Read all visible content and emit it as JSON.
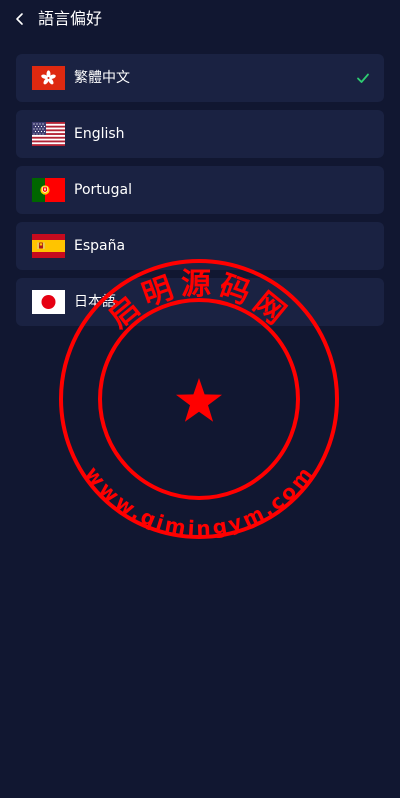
{
  "header": {
    "title": "語言偏好",
    "back_icon": "chevron-left-icon"
  },
  "languages": [
    {
      "label": "繁體中文",
      "flag": "hong-kong-flag-icon",
      "selected": true
    },
    {
      "label": "English",
      "flag": "us-flag-icon",
      "selected": false
    },
    {
      "label": "Portugal",
      "flag": "portugal-flag-icon",
      "selected": false
    },
    {
      "label": "España",
      "flag": "spain-flag-icon",
      "selected": false
    },
    {
      "label": "日本語",
      "flag": "japan-flag-icon",
      "selected": false
    }
  ],
  "watermark": {
    "top_text": "启明源码网",
    "bottom_text": "www.qimingym.com"
  },
  "colors": {
    "background": "#111731",
    "card": "#1a2242",
    "check": "#2ecc71",
    "stamp": "#ff0000"
  }
}
